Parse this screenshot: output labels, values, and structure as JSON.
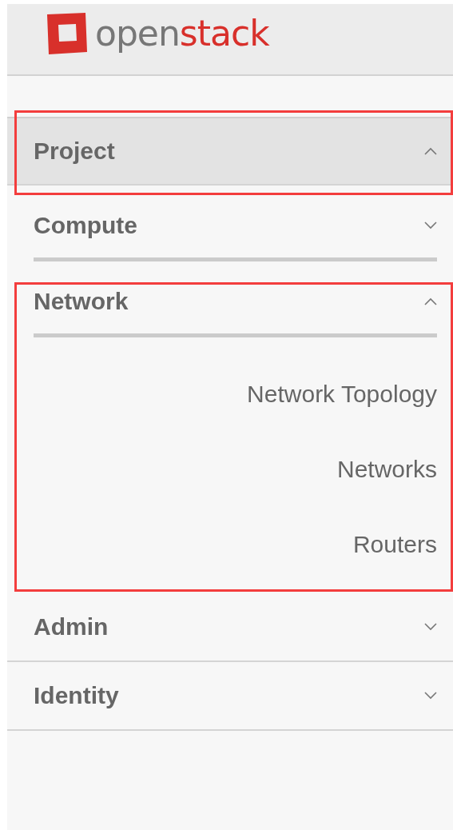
{
  "logo": {
    "first": "open",
    "second": "stack"
  },
  "menu": [
    {
      "label": "Project",
      "expanded": true,
      "selected": true,
      "annotated": true,
      "children": [
        {
          "label": "Compute",
          "expanded": false,
          "annotated": false
        },
        {
          "label": "Network",
          "expanded": true,
          "annotated": true,
          "children": [
            {
              "label": "Network Topology"
            },
            {
              "label": "Networks"
            },
            {
              "label": "Routers"
            }
          ]
        }
      ]
    },
    {
      "label": "Admin",
      "expanded": false,
      "selected": false,
      "annotated": false
    },
    {
      "label": "Identity",
      "expanded": false,
      "selected": false,
      "annotated": false
    }
  ]
}
